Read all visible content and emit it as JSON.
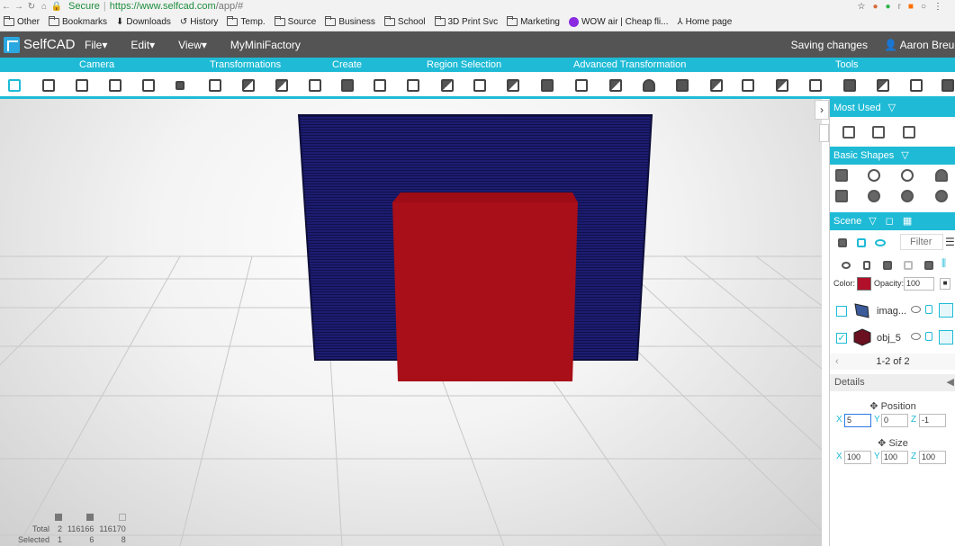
{
  "browser": {
    "secure_label": "Secure",
    "url_host": "https://www.selfcad.com",
    "url_path": "/app/#",
    "bookmarks": [
      "Other",
      "Bookmarks",
      "Downloads",
      "History",
      "Temp.",
      "Source",
      "Business",
      "School",
      "3D Print Svc",
      "Marketing",
      "WOW air | Cheap fli...",
      "Home page"
    ]
  },
  "app": {
    "logo_text": "SelfCAD",
    "menus": [
      "File",
      "Edit",
      "View",
      "MyMiniFactory"
    ],
    "status": "Saving changes",
    "user": "Aaron Breue"
  },
  "categories": [
    "Camera",
    "Transformations",
    "Create",
    "Region Selection",
    "Advanced Transformation",
    "Tools"
  ],
  "panel": {
    "most_used": "Most Used",
    "basic_shapes": "Basic Shapes",
    "scene": "Scene",
    "filter_placeholder": "Filter",
    "color_label": "Color:",
    "color_value": "#b0102a",
    "opacity_label": "Opacity:",
    "opacity_value": "100",
    "objects": [
      {
        "name": "imag...",
        "checked": false
      },
      {
        "name": "obj_5",
        "checked": true
      }
    ],
    "pager": "1-2 of 2",
    "details": "Details",
    "position_label": "Position",
    "size_label": "Size",
    "axis": {
      "x": "X",
      "y": "Y",
      "z": "Z"
    },
    "position": {
      "x": "5",
      "y": "0",
      "z": "-1"
    },
    "size": {
      "x": "100",
      "y": "100",
      "z": "100"
    }
  },
  "stats": {
    "total_label": "Total",
    "selected_label": "Selected",
    "total": [
      "2",
      "116166",
      "116170"
    ],
    "selected": [
      "1",
      "6",
      "8"
    ]
  },
  "colors": {
    "accent": "#1fbbd6",
    "header": "#545454",
    "image_plane": "#1a1a6e",
    "cube": "#b0102a"
  }
}
